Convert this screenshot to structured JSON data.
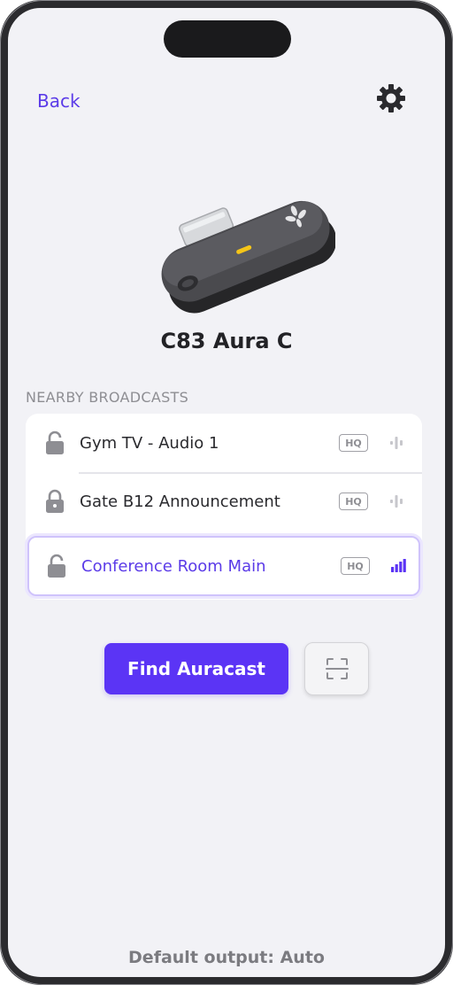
{
  "header": {
    "back_label": "Back",
    "settings_icon": "gear-icon"
  },
  "device": {
    "name": "C83 Aura C",
    "image_icon": "usb-c-dongle-icon",
    "indicator_color": "#f5c518"
  },
  "broadcasts": {
    "section_title": "NEARBY BROADCASTS",
    "items": [
      {
        "title": "Gym TV - Audio 1",
        "badge": "HQ",
        "lock_icon": "lock-open-icon",
        "signal_icon": "signal-inactive-icon",
        "selected": false
      },
      {
        "title": "Gate B12 Announcement",
        "badge": "HQ",
        "lock_icon": "lock-closed-icon",
        "signal_icon": "signal-inactive-icon",
        "selected": false
      },
      {
        "title": "Conference Room Main",
        "badge": "HQ",
        "lock_icon": "lock-open-icon",
        "signal_icon": "signal-strength-icon",
        "selected": true
      }
    ]
  },
  "actions": {
    "find_label": "Find Auracast",
    "scan_icon": "qr-scan-icon"
  },
  "footer": {
    "output_label": "Default output: Auto"
  },
  "colors": {
    "accent": "#5b34f5",
    "background": "#f2f2f6",
    "card": "#ffffff",
    "muted": "#8e8e93"
  }
}
